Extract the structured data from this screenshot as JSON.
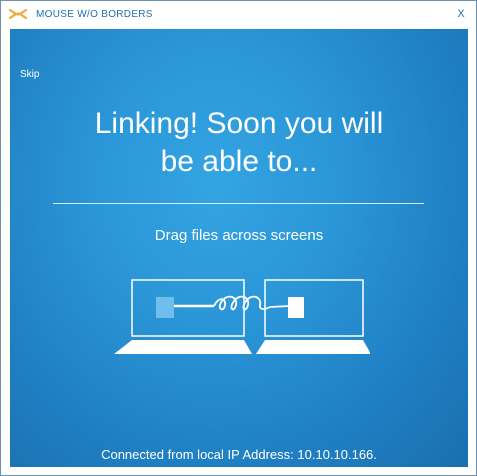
{
  "window": {
    "title": "MOUSE W/O BORDERS",
    "close_label": "X",
    "icon": "mouse-without-borders-icon"
  },
  "content": {
    "skip_label": "Skip",
    "headline_line1": "Linking! Soon you will",
    "headline_line2": "be able to...",
    "feature_text": "Drag files across screens",
    "status_text": "Connected from local IP Address: 10.10.10.166."
  },
  "colors": {
    "accent": "#1f6fb3",
    "background": "#2a96d7"
  }
}
